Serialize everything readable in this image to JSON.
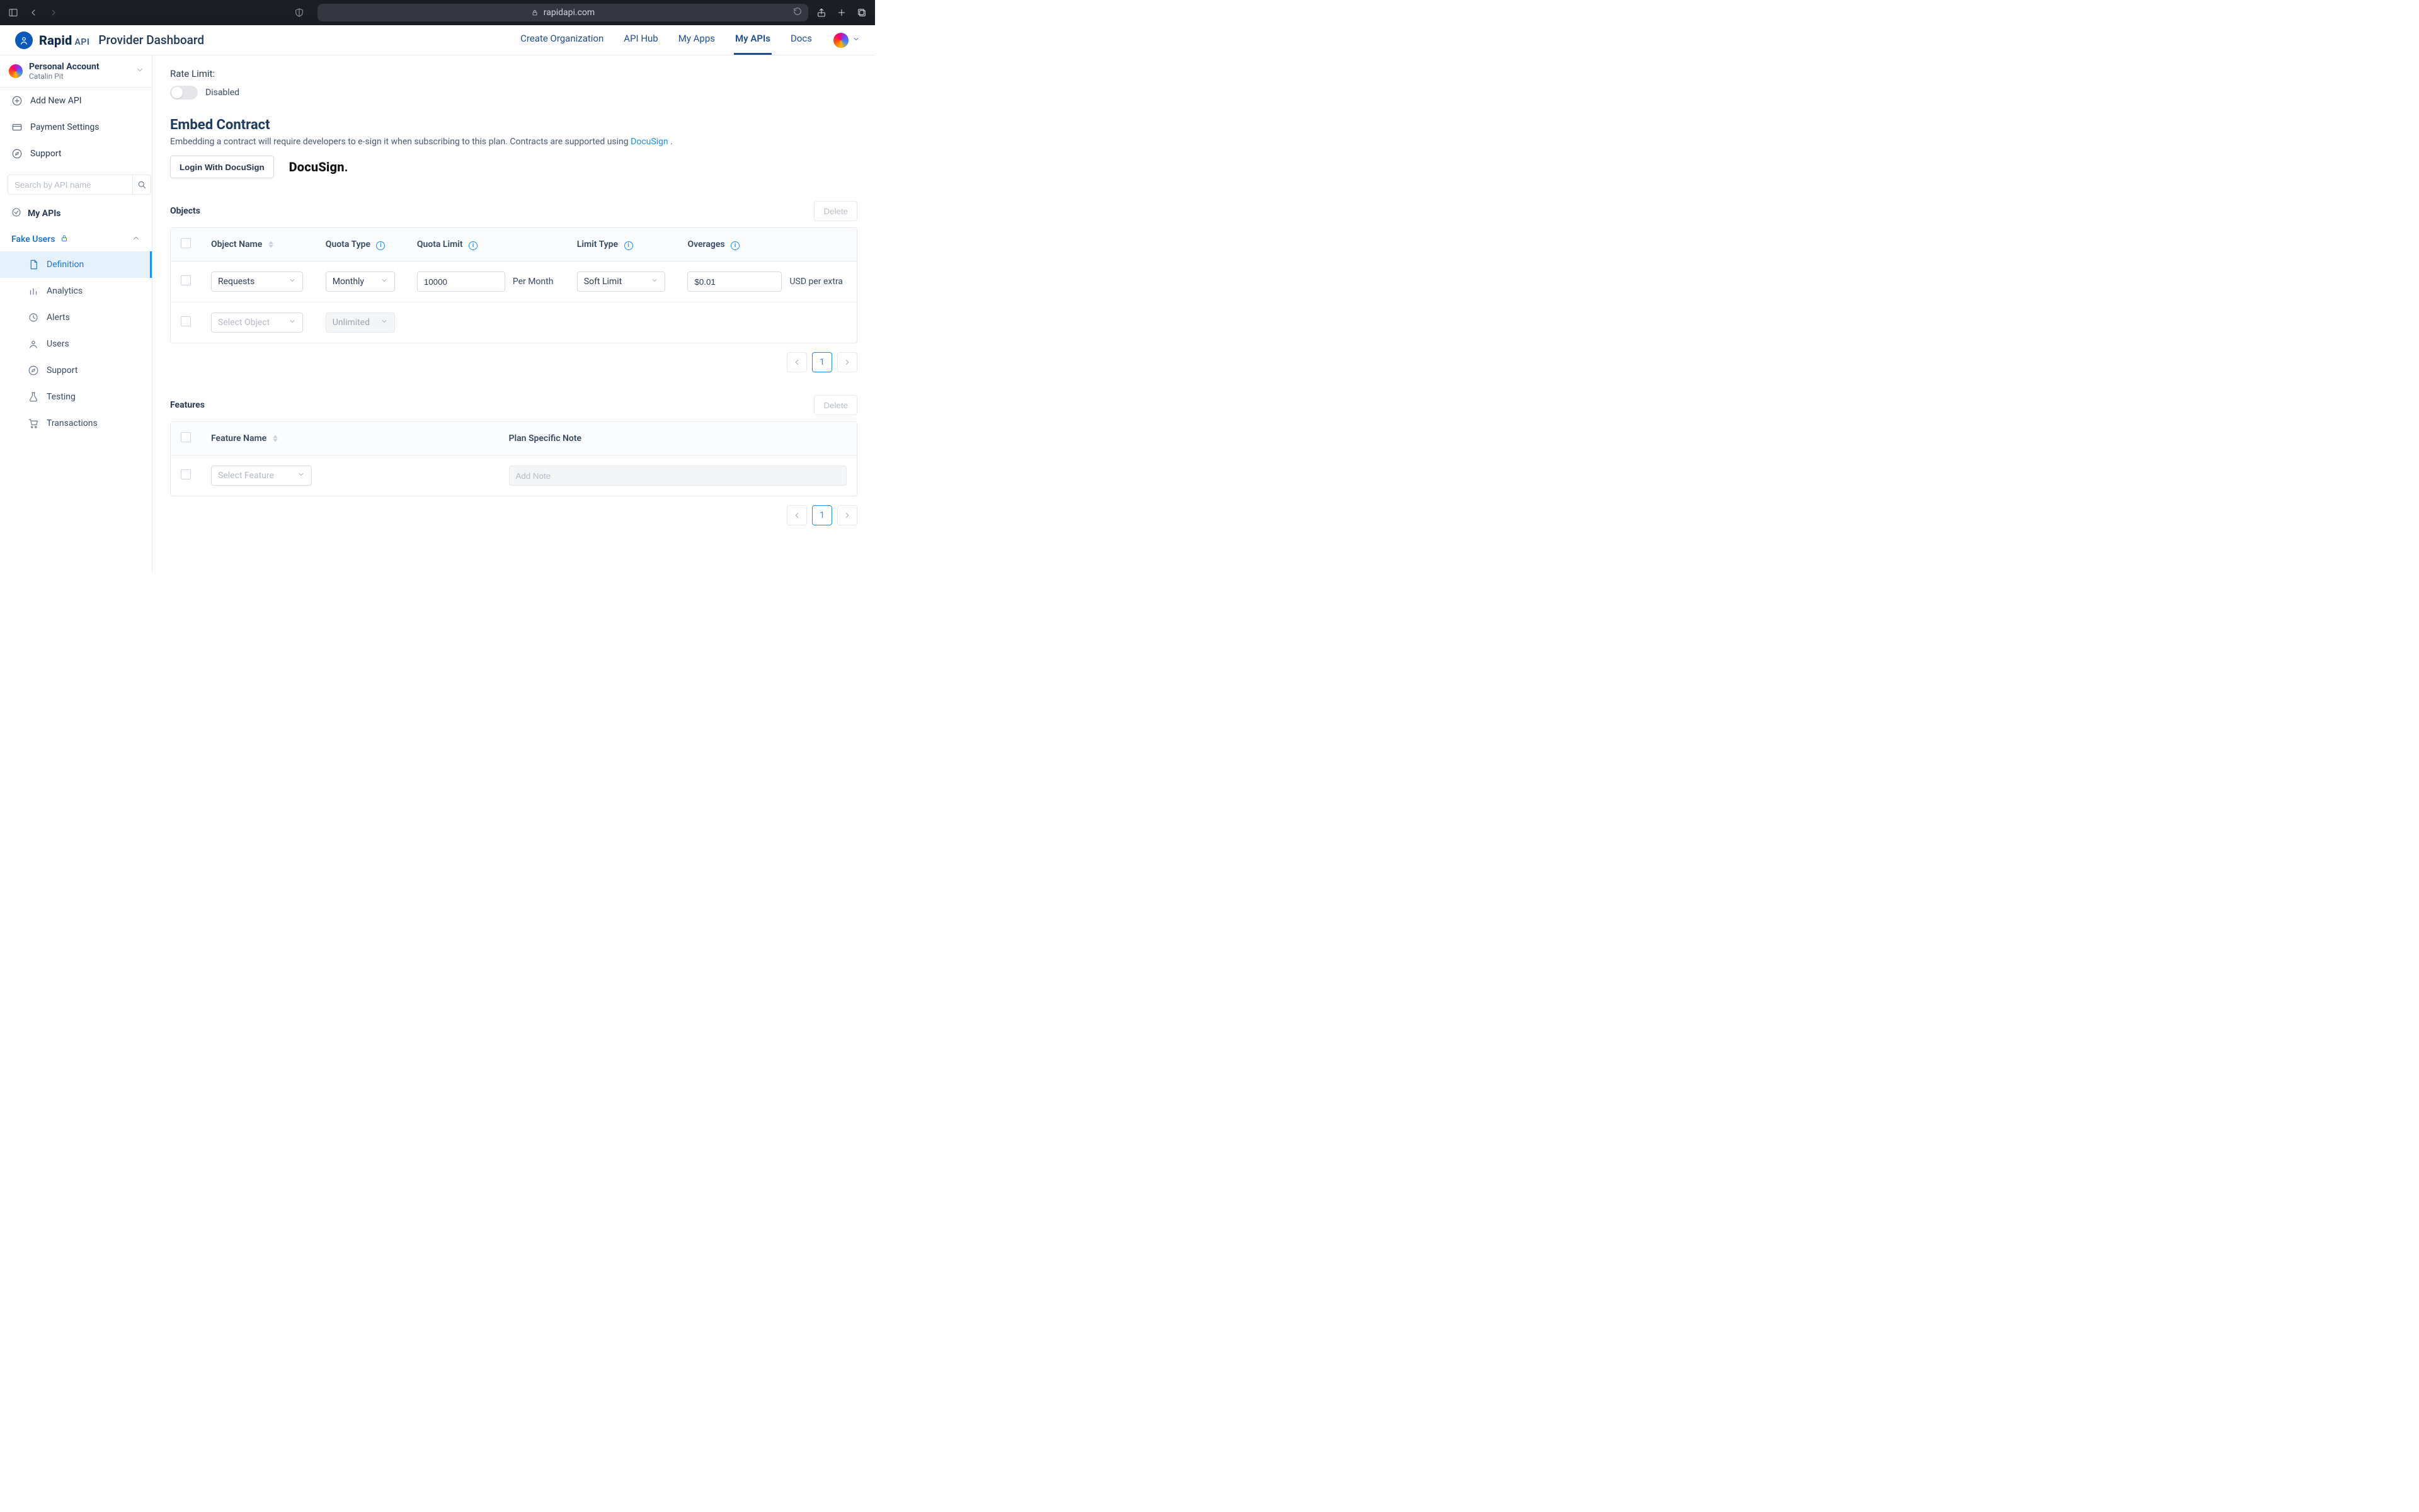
{
  "safari": {
    "domain": "rapidapi.com"
  },
  "header": {
    "brand_rapid": "Rapid",
    "brand_api": "API",
    "subtitle": "Provider Dashboard",
    "nav": {
      "create_org": "Create Organization",
      "api_hub": "API Hub",
      "my_apps": "My Apps",
      "my_apis": "My APIs",
      "docs": "Docs"
    }
  },
  "sidebar": {
    "account": {
      "title": "Personal Account",
      "name": "Catalin Pit"
    },
    "add_new_api": "Add New API",
    "payment_settings": "Payment Settings",
    "support": "Support",
    "search_placeholder": "Search by API name",
    "my_apis": "My APIs",
    "api_group": "Fake Users",
    "items": {
      "definition": "Definition",
      "analytics": "Analytics",
      "alerts": "Alerts",
      "users": "Users",
      "support": "Support",
      "testing": "Testing",
      "transactions": "Transactions"
    }
  },
  "main": {
    "rate_limit_label": "Rate Limit:",
    "rate_limit_state": "Disabled",
    "embed_title": "Embed Contract",
    "embed_desc_pre": "Embedding a contract will require developers to e-sign it when subscribing to this plan. Contracts are supported using ",
    "embed_link": "DocuSign",
    "embed_desc_post": ".",
    "login_docusign": "Login With DocuSign",
    "docusign_word": "DocuSign",
    "objects": {
      "title": "Objects",
      "delete": "Delete",
      "cols": {
        "object_name": "Object Name",
        "quota_type": "Quota Type",
        "quota_limit": "Quota Limit",
        "limit_type": "Limit Type",
        "overages": "Overages"
      },
      "row1": {
        "name": "Requests",
        "quota_type": "Monthly",
        "quota_limit": "10000",
        "per": "Per Month",
        "limit_type": "Soft Limit",
        "overage": "$0.01",
        "overage_unit": "USD per extra"
      },
      "row2": {
        "name_placeholder": "Select Object",
        "quota_type": "Unlimited"
      },
      "page": "1"
    },
    "features": {
      "title": "Features",
      "delete": "Delete",
      "cols": {
        "feature_name": "Feature Name",
        "plan_note": "Plan Specific Note"
      },
      "row1": {
        "name_placeholder": "Select Feature",
        "note_placeholder": "Add Note"
      },
      "page": "1"
    }
  }
}
